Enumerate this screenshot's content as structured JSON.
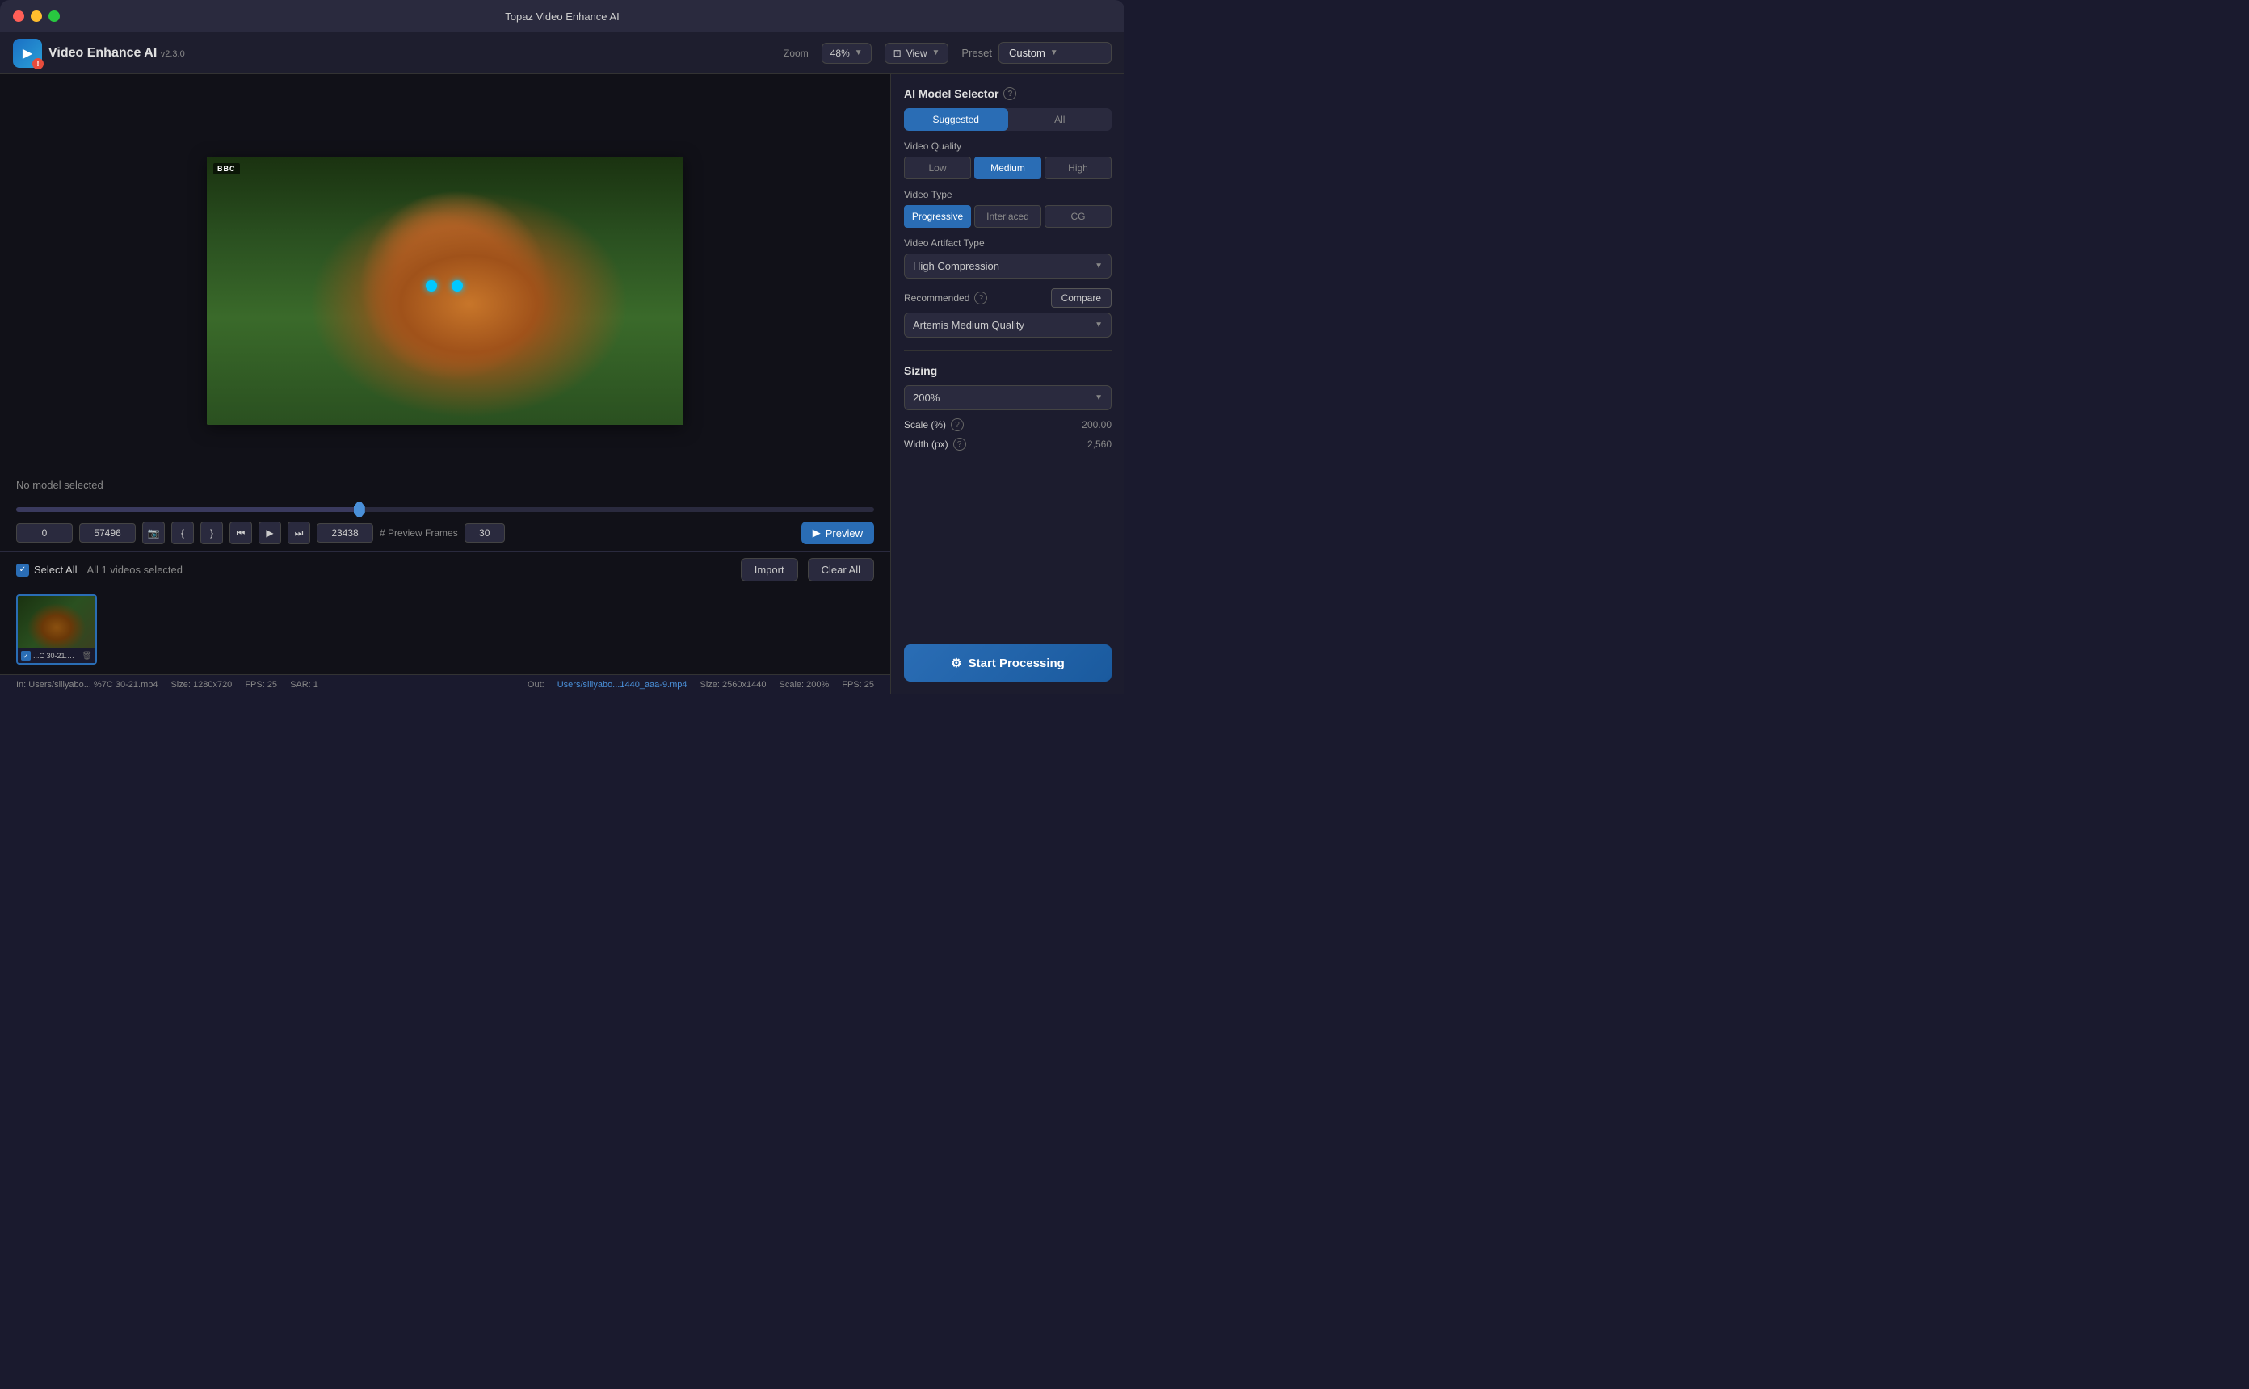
{
  "window": {
    "title": "Topaz Video Enhance AI"
  },
  "toolbar": {
    "app_name": "Video Enhance AI",
    "app_version": "v2.3.0",
    "zoom_label": "Zoom",
    "zoom_value": "48%",
    "view_label": "View",
    "preset_label": "Preset",
    "preset_value": "Custom"
  },
  "video": {
    "no_model_label": "No model selected",
    "bbc_badge": "BBC",
    "frame_start": "0",
    "frame_end": "57496",
    "frame_current": "23438",
    "preview_frames_label": "# Preview Frames",
    "preview_frames_value": "30",
    "preview_btn_label": "Preview"
  },
  "file_list": {
    "select_all_label": "Select All",
    "selected_count": "All 1 videos selected",
    "import_btn": "Import",
    "clear_all_btn": "Clear All",
    "file_name": "...C 30-21.mp4"
  },
  "status_bar": {
    "in_label": "In: Users/sillyabo... %7C 30-21.mp4",
    "size_label": "Size: 1280x720",
    "fps_label": "FPS: 25",
    "sar_label": "SAR: 1",
    "out_label": "Out:",
    "out_link": "Users/sillyabo...1440_aaa-9.mp4",
    "out_size": "Size: 2560x1440",
    "out_scale": "Scale: 200%",
    "out_fps": "FPS: 25"
  },
  "right_panel": {
    "ai_model_title": "AI Model Selector",
    "tabs": {
      "suggested": "Suggested",
      "all": "All"
    },
    "video_quality": {
      "label": "Video Quality",
      "options": [
        "Low",
        "Medium",
        "High"
      ],
      "active": "Medium"
    },
    "video_type": {
      "label": "Video Type",
      "options": [
        "Progressive",
        "Interlaced",
        "CG"
      ],
      "active": "Progressive"
    },
    "video_artifact": {
      "label": "Video Artifact Type",
      "value": "High Compression"
    },
    "recommended": {
      "label": "Recommended",
      "compare_btn": "Compare",
      "value": "Artemis Medium Quality"
    },
    "sizing": {
      "label": "Sizing",
      "dropdown_value": "200%",
      "scale_label": "Scale (%)",
      "scale_value": "200.00",
      "width_label": "Width (px)",
      "width_value": "2,560"
    },
    "start_btn": "Start Processing"
  }
}
